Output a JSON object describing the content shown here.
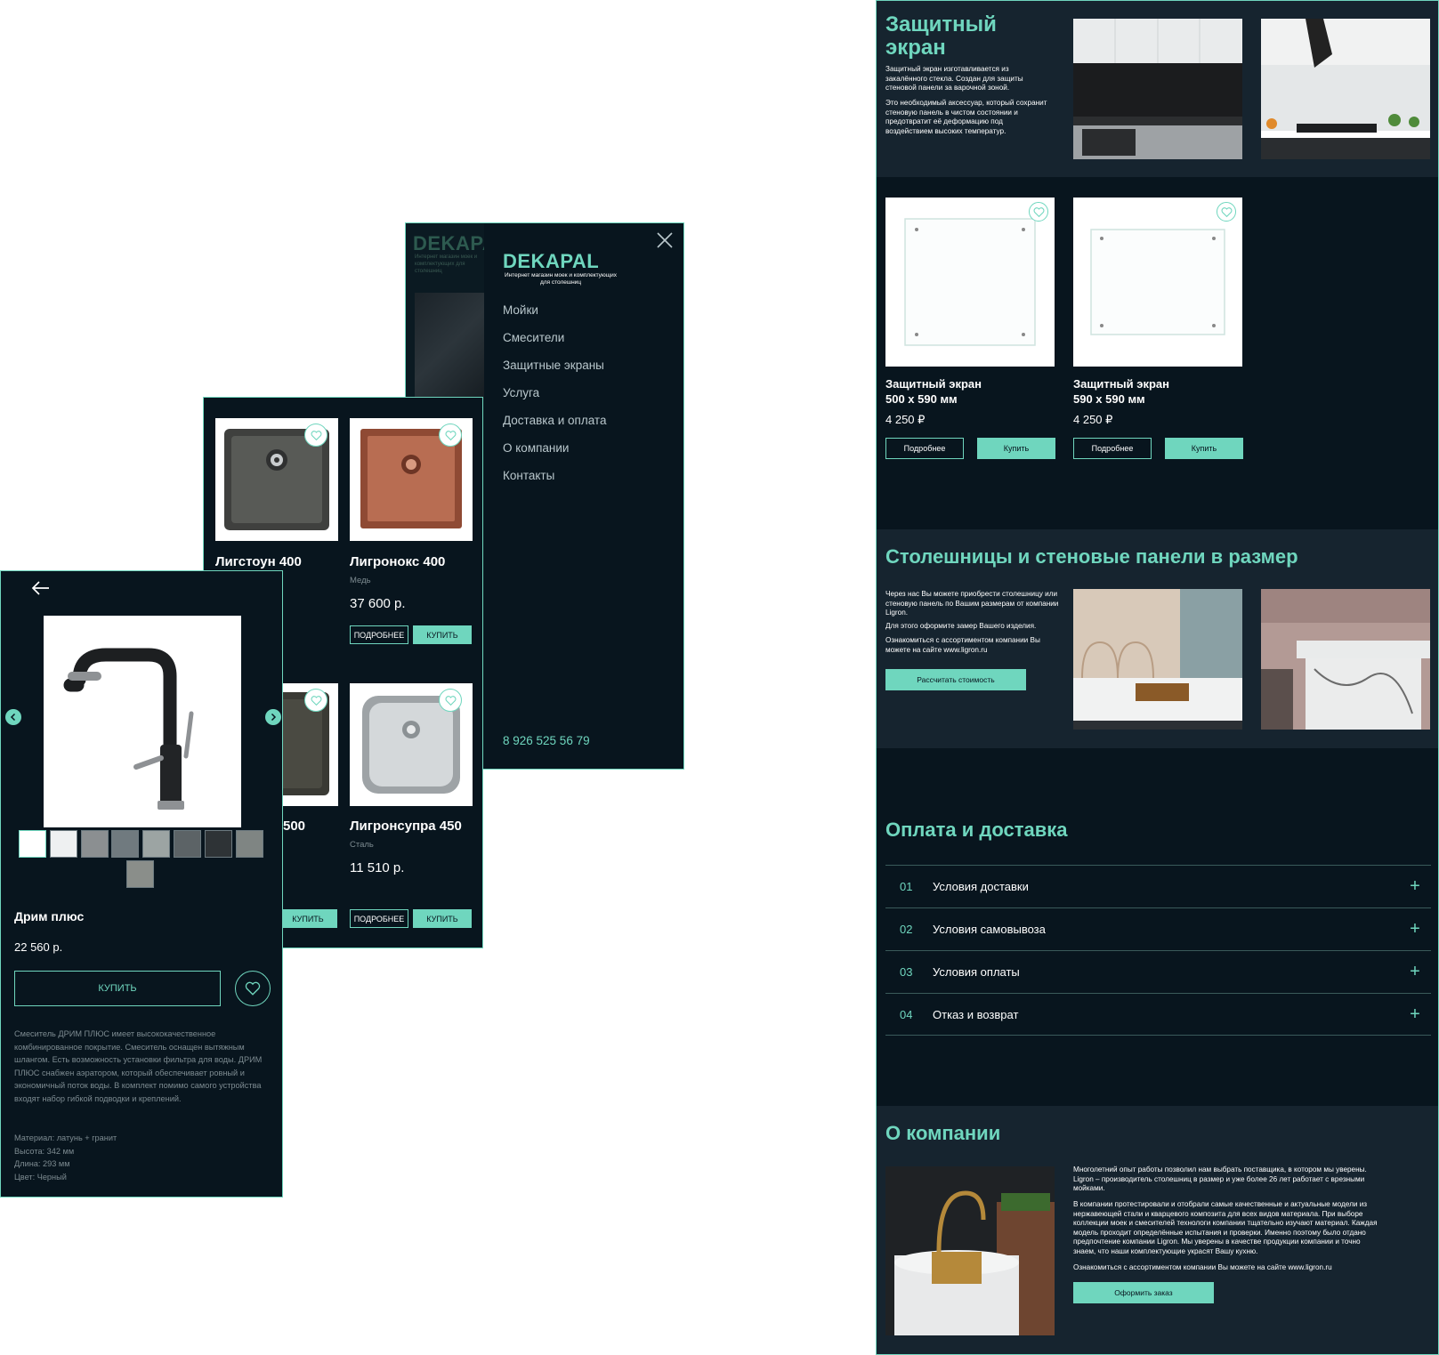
{
  "menu": {
    "logo": "DEKAPAL",
    "logo_sub": "Интернет магазин моек и комплектующих для столешниц",
    "items": [
      "Мойки",
      "Смесители",
      "Защитные экраны",
      "Услуга",
      "Доставка и оплата",
      "О компании",
      "Контакты"
    ],
    "phone": "8 926 525 56 79"
  },
  "catalog": {
    "products": [
      {
        "name": "Лигстоун 400",
        "sub": "",
        "price": ""
      },
      {
        "name": "Лигронокс 400",
        "sub": "Медь",
        "price": "37 600 р."
      },
      {
        "name": "500",
        "sub": "",
        "price": ""
      },
      {
        "name": "Лигронсупра 450",
        "sub": "Сталь",
        "price": "11 510 р."
      }
    ],
    "more_label": "ПОДРОБНЕЕ",
    "buy_label": "КУПИТЬ"
  },
  "product": {
    "name": "Дрим плюс",
    "price": "22 560 р.",
    "buy_label": "КУПИТЬ",
    "description": "Смеситель ДРИМ ПЛЮС имеет высококачественное комбинированное покрытие. Смеситель оснащен вытяжным шлангом. Есть возможность установки фильтра для воды. ДРИМ ПЛЮС снабжен аэратором, который обеспечивает ровный и экономичный поток воды. В комплект помимо самого устройства входят набор гибкой подводки и креплений.",
    "specs": [
      "Материал: латунь + гранит",
      "Высота: 342 мм",
      "Длина: 293 мм",
      "Цвет: Черный"
    ]
  },
  "landing": {
    "screen": {
      "title": "Защитный экран",
      "p1": "Защитный экран изготавливается из закалённого стекла. Создан для защиты стеновой панели за варочной зоной.",
      "p2": "Это необходимый аксессуар, который сохранит стеновую панель в чистом состоянии и предотвратит её деформацию под воздействием высоких температур."
    },
    "screens": [
      {
        "name": "Защитный экран",
        "size": "500 х 590 мм",
        "price": "4 250 ₽"
      },
      {
        "name": "Защитный экран",
        "size": "590 х 590 мм",
        "price": "4 250 ₽"
      }
    ],
    "more_label": "Подробнее",
    "buy_label": "Купить",
    "countertops": {
      "title": "Столешницы и стеновые панели в размер",
      "p1": "Через нас Вы можете приобрести столешницу или стеновую панель по Вашим размерам от компании Ligron.",
      "p2": "Для этого оформите замер Вашего изделия.",
      "p3": "Ознакомиться с ассортиментом компании Вы можете на сайте www.ligron.ru",
      "button": "Рассчитать стоимость"
    },
    "payment": {
      "title": "Оплата и доставка",
      "rows": [
        {
          "num": "01",
          "label": "Условия доставки"
        },
        {
          "num": "02",
          "label": "Условия самовывоза"
        },
        {
          "num": "03",
          "label": "Условия оплаты"
        },
        {
          "num": "04",
          "label": "Отказ и возврат"
        }
      ],
      "plus": "+"
    },
    "about": {
      "title": "О компании",
      "p1": "Многолетний опыт работы позволил нам выбрать поставщика, в котором мы уверены. Ligron – производитель столешниц в размер и уже более 26 лет работает с врезными мойками.",
      "p2": "В компании протестировали и отобрали самые качественные и актуальные модели из нержавеющей стали и кварцевого композита для всех видов материала. При выборе коллекции моек и смесителей технологи компании тщательно изучают материал. Каждая модель проходит определённые испытания и проверки. Именно поэтому было отдано предпочтение компании Ligron. Мы уверены в качестве продукции компании и точно знаем, что наши комплектующие украсят Вашу кухню.",
      "p3": "Ознакомиться с ассортиментом компании Вы можете на сайте www.ligron.ru",
      "button": "Оформить заказ"
    }
  },
  "colors": {
    "accent": "#6fd6be",
    "bg": "#08151e",
    "bg_light": "#16242f"
  }
}
